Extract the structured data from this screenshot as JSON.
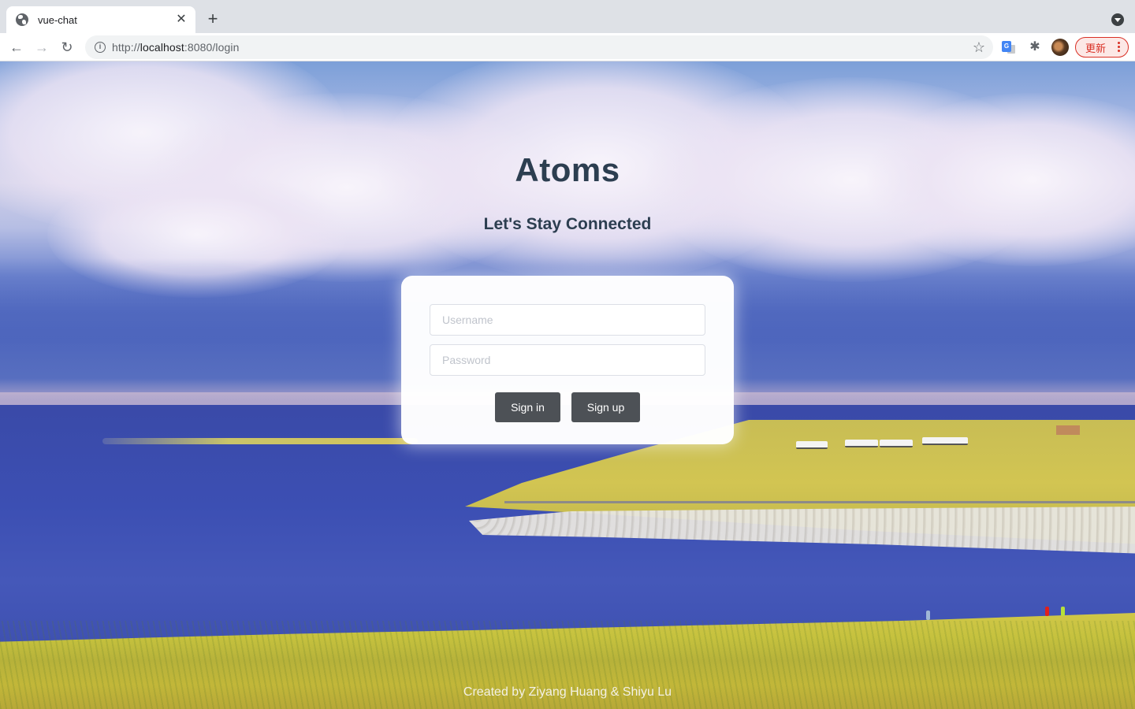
{
  "browser": {
    "tab": {
      "title": "vue-chat",
      "favicon": "globe-icon",
      "close_glyph": "✕"
    },
    "new_tab_glyph": "+",
    "nav": {
      "back_glyph": "←",
      "forward_glyph": "→",
      "reload_glyph": "↻"
    },
    "address": {
      "scheme": "http://",
      "host": "localhost",
      "rest": ":8080/login",
      "info_glyph": "i"
    },
    "bookmark_glyph": "☆",
    "extension_glyph": "✱",
    "update_button": {
      "label": "更新"
    }
  },
  "page": {
    "title": "Atoms",
    "subtitle": "Let's Stay Connected",
    "login": {
      "username_placeholder": "Username",
      "username_value": "",
      "password_placeholder": "Password",
      "password_value": "",
      "signin_label": "Sign in",
      "signup_label": "Sign up"
    },
    "footer": "Created by Ziyang Huang & Shiyu Lu",
    "colors": {
      "heading": "#2c3e50",
      "button_bg": "#4d5156",
      "update_accent": "#d93025"
    }
  }
}
